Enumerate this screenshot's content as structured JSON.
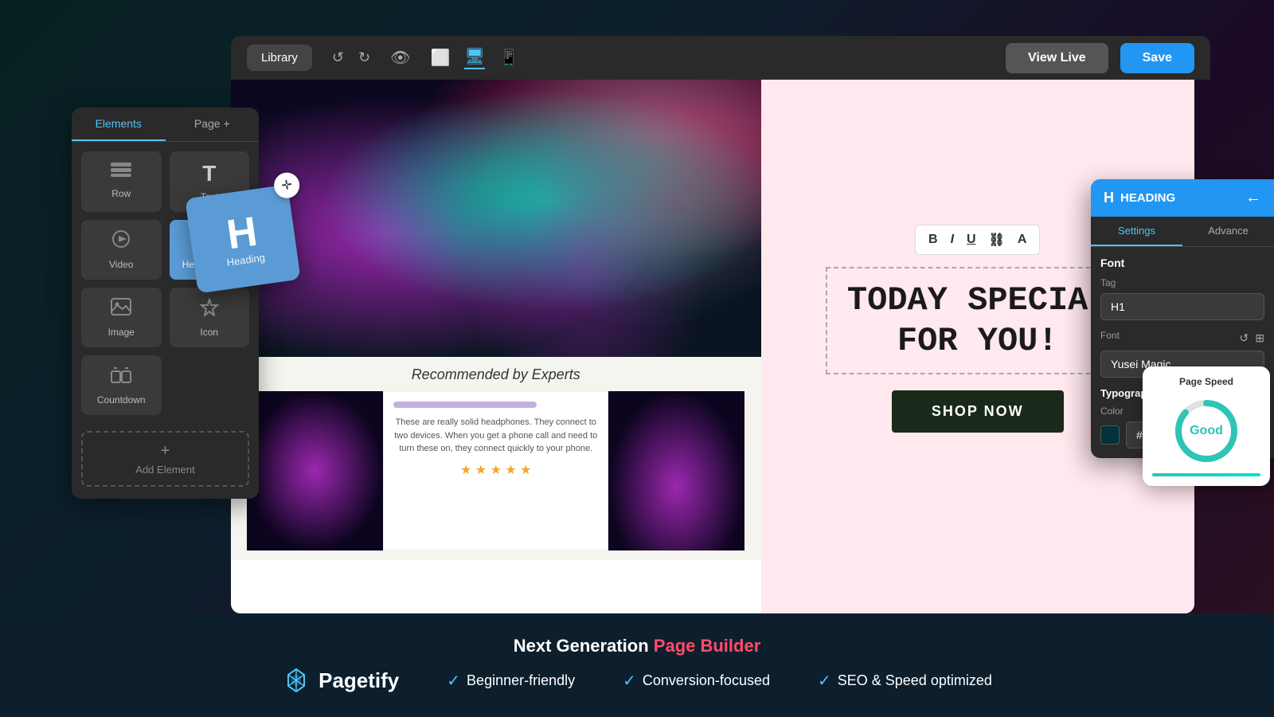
{
  "app": {
    "title": "Pagetify",
    "tagline_static": "Next Generation",
    "tagline_highlight": "Page Builder",
    "features": [
      {
        "label": "Beginner-friendly"
      },
      {
        "label": "Conversion-focused"
      },
      {
        "label": "SEO & Speed optimized"
      }
    ]
  },
  "toolbar": {
    "library_label": "Library",
    "view_live_label": "View Live",
    "save_label": "Save"
  },
  "elements_panel": {
    "tab_elements": "Elements",
    "tab_page": "Page +",
    "items": [
      {
        "id": "row",
        "label": "Row",
        "icon": "☰"
      },
      {
        "id": "text",
        "label": "Text",
        "icon": "T"
      },
      {
        "id": "video",
        "label": "Video",
        "icon": "▶"
      },
      {
        "id": "hero-banner",
        "label": "Hero Banner",
        "icon": "⚡"
      },
      {
        "id": "image",
        "label": "Image",
        "icon": "🖼"
      },
      {
        "id": "icon",
        "label": "Icon",
        "icon": "△"
      },
      {
        "id": "countdown",
        "label": "Countdown",
        "icon": "⏳"
      }
    ],
    "add_element_label": "Add Element"
  },
  "heading_drag": {
    "letter": "H",
    "label": "Heading"
  },
  "canvas": {
    "special_text_line1": "TODAY SPECIAL",
    "special_text_line2": "FOR YOU!",
    "shop_btn": "SHOP NOW",
    "recommended_title": "Recommended by Experts",
    "review_text": "These are really solid headphones. They connect to two devices. When you get a phone call and need to turn these on, they connect quickly to your phone.",
    "stars": "★ ★ ★ ★ ★"
  },
  "heading_panel": {
    "title": "HEADING",
    "tab_settings": "Settings",
    "tab_advance": "Advance",
    "font_section": "Font",
    "tag_label": "Tag",
    "tag_value": "H1",
    "font_label": "Font",
    "font_value": "Yusei Magic",
    "typography_label": "Typography",
    "color_label": "Color",
    "color_value": "#02333B"
  },
  "page_speed": {
    "title": "Page Speed",
    "rating": "Good",
    "score": 85
  },
  "text_toolbar": {
    "bold": "B",
    "italic": "I",
    "underline": "U",
    "link": "⛓",
    "align": "A"
  }
}
